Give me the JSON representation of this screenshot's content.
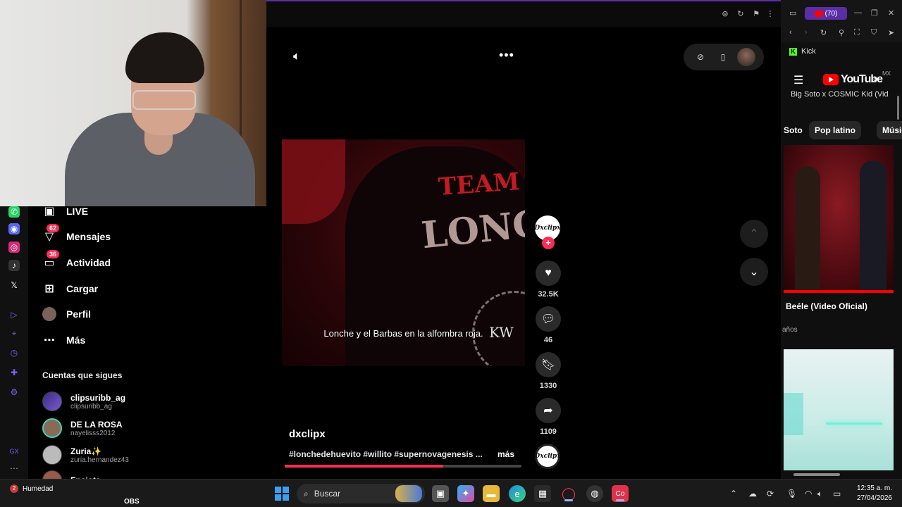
{
  "topbar": {
    "icons": [
      "settings-icon",
      "reload-icon",
      "pin-icon",
      "menu-dots-icon"
    ]
  },
  "tiktok_nav": {
    "items": [
      {
        "label": "LIVE",
        "icon": "live-icon"
      },
      {
        "label": "Mensajes",
        "icon": "messages-icon",
        "badge": "62"
      },
      {
        "label": "Actividad",
        "icon": "activity-icon",
        "badge": "36"
      },
      {
        "label": "Cargar",
        "icon": "upload-icon"
      },
      {
        "label": "Perfil",
        "icon": "profile-icon"
      },
      {
        "label": "Más",
        "icon": "more-icon"
      }
    ],
    "following_title": "Cuentas que sigues",
    "following": [
      {
        "name": "clipsuribb_ag",
        "handle": "clipsuribb_ag"
      },
      {
        "name": "DE LA ROSA",
        "handle": "nayelisss2012"
      },
      {
        "name": "Zuria✨",
        "handle": "zuria.hernandez43"
      },
      {
        "name": "Fnciota",
        "handle": ""
      }
    ]
  },
  "video": {
    "caption": "Lonche y el Barbas en la alfombra roja.",
    "author": "dxclipx",
    "hashtags": "#lonchedehuevito #willito #supernovagenesis ...",
    "more_label": "más",
    "progress": 0.67,
    "shirt_top": "TEAM",
    "shirt_main": "LONCH",
    "watch_text": "KW"
  },
  "actions": {
    "creator_avatar_text": "Dxclipx",
    "likes": "32.5K",
    "comments": "46",
    "saves": "1330",
    "shares": "1109"
  },
  "youtube": {
    "badge_count": "(70)",
    "kick_label": "Kick",
    "logo_text": "YouTube",
    "region": "MX",
    "truncated_title": "Big Soto x COSMIC Kid (Vid",
    "chips": [
      "Soto",
      "Pop latino",
      "Músic"
    ],
    "video_title": "Beéle (Video Oficial)",
    "video_meta": "años"
  },
  "taskbar": {
    "weather": "Humedad",
    "weather_badge": "2",
    "obs": "OBS",
    "search_placeholder": "Buscar",
    "time": "12:35 a. m.",
    "date": "27/04/2026"
  },
  "colors": {
    "accent": "#fe2c55",
    "youtube_red": "#ff0000",
    "kick_green": "#53fc18",
    "opera_purple": "#5b2ea6"
  }
}
